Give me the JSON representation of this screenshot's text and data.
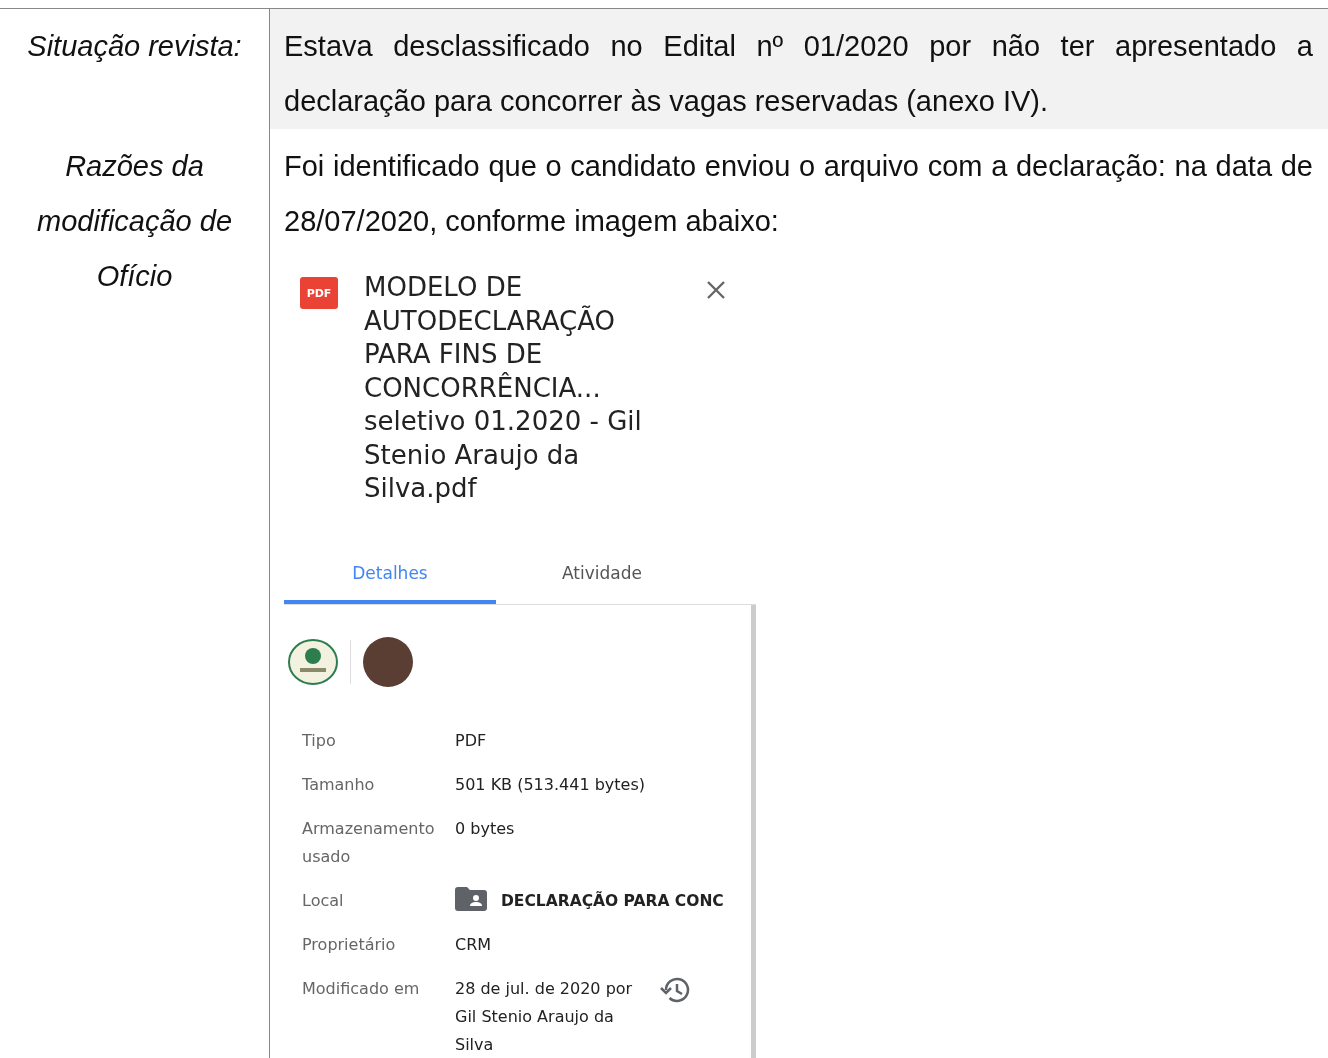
{
  "rows": [
    {
      "label": "Situação revista:",
      "text": "Estava desclassificado no Edital nº 01/2020 por não ter apresentado a declaração para concorrer às vagas reservadas (anexo IV).",
      "shaded": true
    },
    {
      "label": "Razões da modificação de Ofício",
      "text": "Foi identificado que o candidato enviou o arquivo com a declaração: na data de 28/07/2020, conforme imagem abaixo:",
      "shaded": false
    }
  ],
  "file_panel": {
    "badge": "PDF",
    "file_name": "MODELO DE AUTODECLARAÇÃO PARA FINS DE CONCORRÊNCIA... seletivo 01.2020 - Gil Stenio Araujo da Silva.pdf",
    "tabs": [
      {
        "label": "Detalhes",
        "selected": true
      },
      {
        "label": "Atividade",
        "selected": false
      }
    ],
    "details": [
      {
        "label": "Tipo",
        "value": "PDF",
        "kind": "plain"
      },
      {
        "label": "Tamanho",
        "value": "501 KB (513.441 bytes)",
        "kind": "plain"
      },
      {
        "label": "Armazenamento usado",
        "value": "0 bytes",
        "kind": "plain"
      },
      {
        "label": "Local",
        "value": "DECLARAÇÃO PARA CONC",
        "kind": "folder"
      },
      {
        "label": "Proprietário",
        "value": "CRM",
        "kind": "plain"
      },
      {
        "label": "Modificado em",
        "value": "28 de jul. de 2020 por Gil Stenio Araujo da Silva",
        "kind": "modified"
      }
    ]
  }
}
